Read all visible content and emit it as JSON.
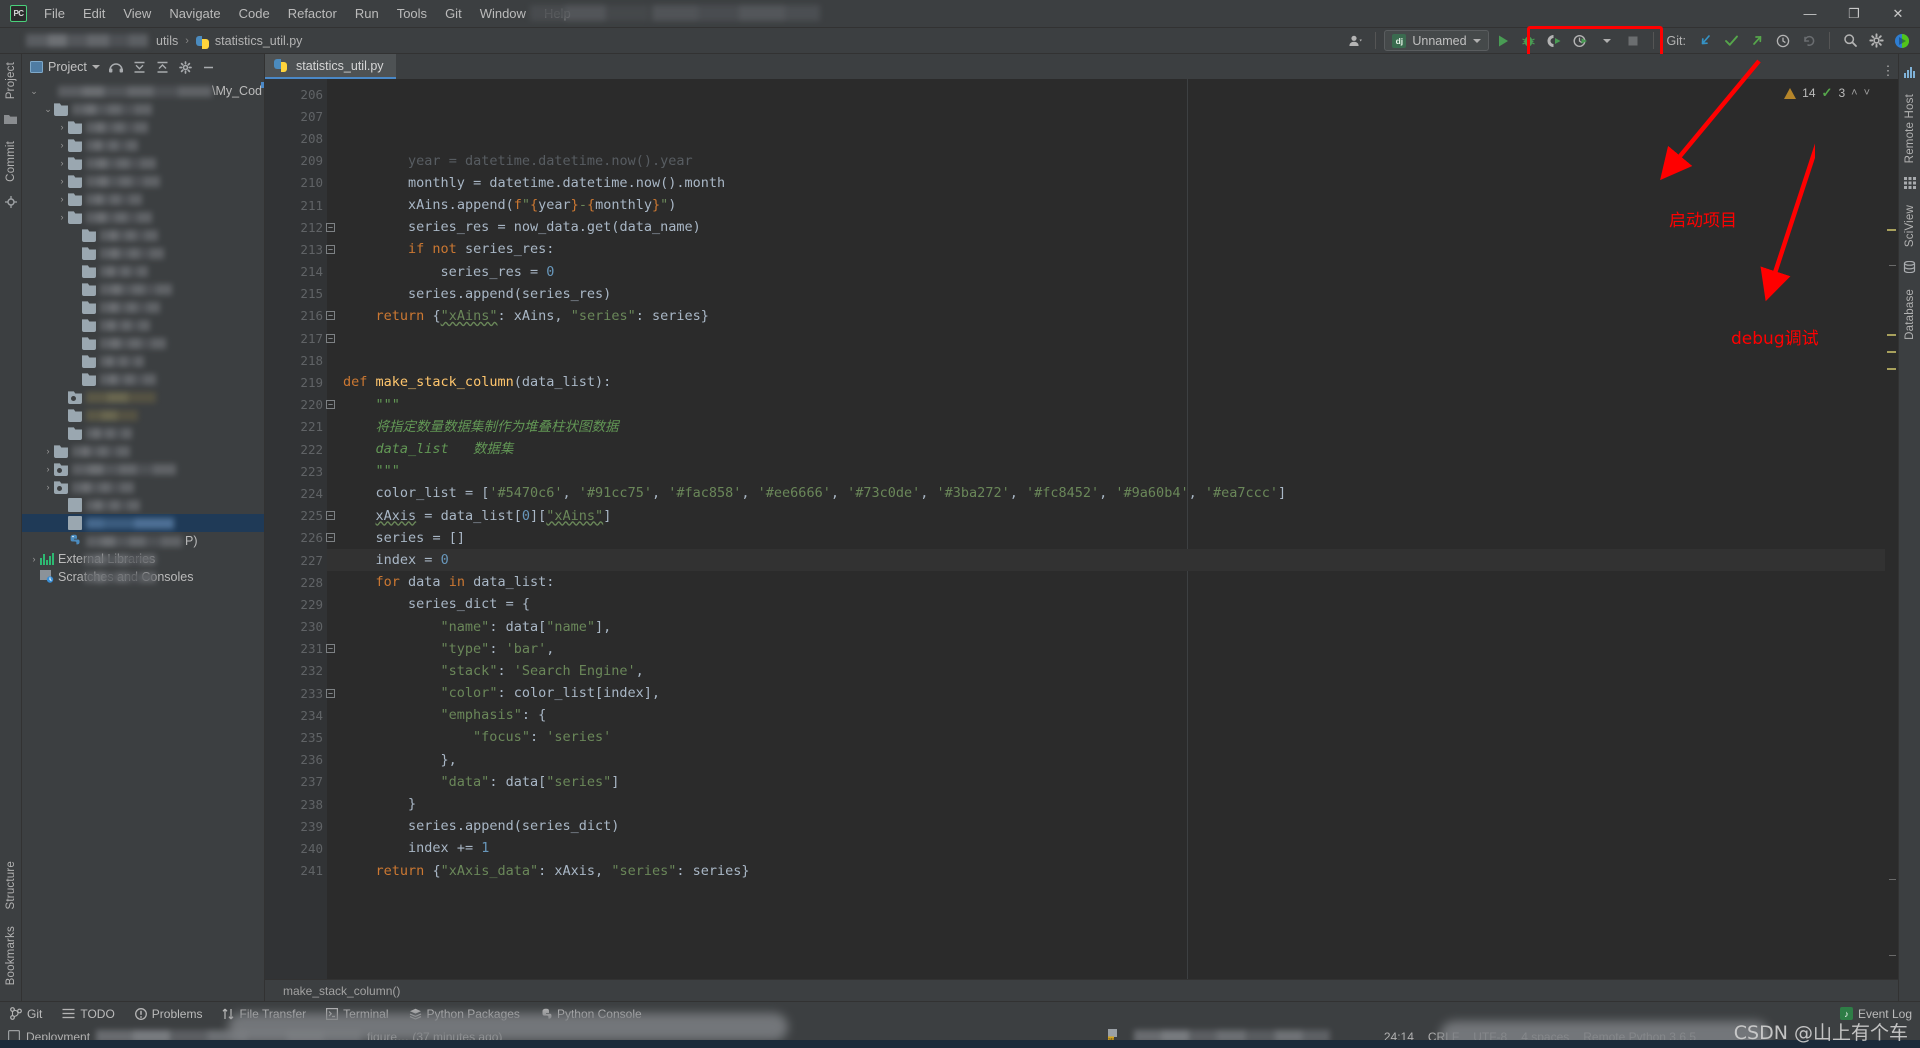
{
  "app": {
    "logo_text": "PC",
    "menu": [
      "File",
      "Edit",
      "View",
      "Navigate",
      "Code",
      "Refactor",
      "Run",
      "Tools",
      "Git",
      "Window",
      "Help"
    ],
    "window_controls": {
      "minimize": "—",
      "maximize": "❐",
      "close": "✕"
    }
  },
  "breadcrumb": {
    "project_redacted": "",
    "folder": "utils",
    "file": "statistics_util.py",
    "separator": "›"
  },
  "toolbar": {
    "avatar_label": "user-account",
    "run_config": {
      "badge": "dj",
      "name": "Unnamed"
    },
    "run_label": "Run",
    "debug_label": "Debug",
    "coverage_label": "Run with Coverage",
    "profile_label": "Profile",
    "stop_label": "Stop",
    "git_label": "Git:",
    "update_label": "Update Project",
    "commit_label": "Commit",
    "push_label": "Push",
    "history_label": "History",
    "rollback_label": "Rollback",
    "search_label": "Search Everywhere",
    "settings_label": "Settings",
    "ide_label": "IDE Feature Trainer"
  },
  "sidebar_left": {
    "tabs_top": [
      "Project",
      "Commit"
    ],
    "tabs_bottom": [
      "Structure",
      "Bookmarks"
    ]
  },
  "sidebar_right": {
    "tabs": [
      "Remote Host",
      "SciView",
      "Database"
    ]
  },
  "project_panel": {
    "title": "Project",
    "actions": [
      "hide-tabs-icon",
      "expand-all-icon",
      "collapse-all-icon",
      "settings-icon",
      "hide-icon"
    ],
    "root_suffix": "\\My_Cod",
    "tree": [
      {
        "indent": 0,
        "arrow": "⌄",
        "icon": "none",
        "label": "",
        "blur": true,
        "blur_w": 176,
        "root": true
      },
      {
        "indent": 1,
        "arrow": "⌄",
        "icon": "folder",
        "label": "",
        "blur": true,
        "blur_w": 80
      },
      {
        "indent": 2,
        "arrow": "›",
        "icon": "folder",
        "label": "",
        "blur": true,
        "blur_w": 62
      },
      {
        "indent": 2,
        "arrow": "›",
        "icon": "folder",
        "label": "",
        "blur": true,
        "blur_w": 52
      },
      {
        "indent": 2,
        "arrow": "›",
        "icon": "folder",
        "label": "",
        "blur": true,
        "blur_w": 70
      },
      {
        "indent": 2,
        "arrow": "›",
        "icon": "folder",
        "label": "",
        "blur": true,
        "blur_w": 74
      },
      {
        "indent": 2,
        "arrow": "›",
        "icon": "folder",
        "label": "",
        "blur": true,
        "blur_w": 56
      },
      {
        "indent": 2,
        "arrow": "›",
        "icon": "folder",
        "label": "",
        "blur": true,
        "blur_w": 66
      },
      {
        "indent": 3,
        "arrow": "",
        "icon": "folder",
        "label": "",
        "blur": true,
        "blur_w": 58
      },
      {
        "indent": 3,
        "arrow": "",
        "icon": "folder",
        "label": "",
        "blur": true,
        "blur_w": 64
      },
      {
        "indent": 3,
        "arrow": "",
        "icon": "folder",
        "label": "",
        "blur": true,
        "blur_w": 48
      },
      {
        "indent": 3,
        "arrow": "",
        "icon": "folder",
        "label": "",
        "blur": true,
        "blur_w": 72
      },
      {
        "indent": 3,
        "arrow": "",
        "icon": "folder",
        "label": "",
        "blur": true,
        "blur_w": 60
      },
      {
        "indent": 3,
        "arrow": "",
        "icon": "folder",
        "label": "",
        "blur": true,
        "blur_w": 50
      },
      {
        "indent": 3,
        "arrow": "",
        "icon": "folder",
        "label": "",
        "blur": true,
        "blur_w": 66
      },
      {
        "indent": 3,
        "arrow": "",
        "icon": "folder",
        "label": "",
        "blur": true,
        "blur_w": 44
      },
      {
        "indent": 3,
        "arrow": "",
        "icon": "folder",
        "label": "",
        "blur": true,
        "blur_w": 56
      },
      {
        "indent": 2,
        "arrow": "",
        "icon": "pkg",
        "label": "",
        "blur": true,
        "blur_w": 70,
        "warm": true
      },
      {
        "indent": 2,
        "arrow": "",
        "icon": "folder",
        "label": "",
        "blur": true,
        "blur_w": 52,
        "warm": true
      },
      {
        "indent": 2,
        "arrow": "",
        "icon": "folder",
        "label": "",
        "blur": true,
        "blur_w": 46
      },
      {
        "indent": 1,
        "arrow": "›",
        "icon": "folder",
        "label": "",
        "blur": true,
        "blur_w": 58
      },
      {
        "indent": 1,
        "arrow": "›",
        "icon": "pkg",
        "label": "",
        "blur": true,
        "blur_w": 104
      },
      {
        "indent": 1,
        "arrow": "›",
        "icon": "pkg",
        "label": "",
        "blur": true,
        "blur_w": 62
      },
      {
        "indent": 2,
        "arrow": "",
        "icon": "file",
        "label": "",
        "blur": true,
        "blur_w": 54
      },
      {
        "indent": 2,
        "arrow": "",
        "icon": "file",
        "label": "",
        "blur": true,
        "blur_w": 88,
        "selected": true
      },
      {
        "indent": 2,
        "arrow": "",
        "icon": "py",
        "label": "",
        "blur": true,
        "blur_w": 96,
        "suffix": "P)"
      },
      {
        "indent": 0,
        "arrow": "›",
        "icon": "lib",
        "label": "External Libraries",
        "blur": false,
        "partial_blur": true
      },
      {
        "indent": 0,
        "arrow": "",
        "icon": "scratch",
        "label": "Scratches and Consoles",
        "blur": false,
        "partial_blur": true
      }
    ]
  },
  "editor": {
    "tab": {
      "label": "statistics_util.py",
      "icon": "python-file-icon"
    },
    "inspection": {
      "warning_count": "14",
      "ok_count": "3",
      "up": "˄",
      "down": "˅"
    },
    "method_breadcrumb": "make_stack_column()",
    "first_line_number": 206,
    "current_line": 224,
    "lines": [
      {
        "n": 206,
        "html": "        <span class='def'>year</span> <span class='pn'>=</span> <span class='def'>datetime</span><span class='pn'>.</span><span class='def'>datetime</span><span class='pn'>.</span><span class='def'>now</span><span class='pn'>().</span><span class='def'>year</span>",
        "clipped": true
      },
      {
        "n": 207,
        "html": "        <span class='def'>monthly</span> <span class='pn'>=</span> <span class='def'>datetime</span><span class='pn'>.</span><span class='def'>datetime</span><span class='pn'>.</span><span class='def'>now</span><span class='pn'>().</span><span class='def'>month</span>"
      },
      {
        "n": 208,
        "html": "        <span class='def'>xAins</span><span class='pn'>.</span><span class='def'>append</span><span class='pn'>(</span><span class='kw'>f</span><span class='str'>\"</span><span class='kw'>{</span><span class='def'>year</span><span class='kw'>}</span><span class='str'>-</span><span class='kw'>{</span><span class='def'>monthly</span><span class='kw'>}</span><span class='str'>\"</span><span class='pn'>)</span>"
      },
      {
        "n": 209,
        "html": "        <span class='def'>series_res</span> <span class='pn'>=</span> <span class='def'>now_data</span><span class='pn'>.</span><span class='def'>get</span><span class='pn'>(</span><span class='def'>data_name</span><span class='pn'>)</span>"
      },
      {
        "n": 210,
        "html": "        <span class='kw'>if not</span> <span class='def'>series_res</span><span class='pn'>:</span>"
      },
      {
        "n": 211,
        "html": "            <span class='def'>series_res</span> <span class='pn'>=</span> <span class='num'>0</span>"
      },
      {
        "n": 212,
        "html": "        <span class='def'>series</span><span class='pn'>.</span><span class='def'>append</span><span class='pn'>(</span><span class='def'>series_res</span><span class='pn'>)</span>",
        "fold": true
      },
      {
        "n": 213,
        "html": "    <span class='kw'>return</span> <span class='pn'>{</span><span class='str err'>\"xAins\"</span><span class='pn'>:</span> <span class='def'>xAins</span><span class='pn'>,</span> <span class='str'>\"series\"</span><span class='pn'>:</span> <span class='def'>series</span><span class='pn'>}</span>",
        "fold": true
      },
      {
        "n": 214,
        "html": ""
      },
      {
        "n": 215,
        "html": ""
      },
      {
        "n": 216,
        "html": "<span class='kw'>def</span> <span class='fn'>make_stack_column</span><span class='pn'>(</span><span class='def'>data_list</span><span class='pn'>):</span>",
        "fold": true
      },
      {
        "n": 217,
        "html": "    <span class='cm'>\"\"\"</span>",
        "fold": true
      },
      {
        "n": 218,
        "html": "    <span class='cm'>将指定数量数据集制作为堆叠柱状图数据</span>"
      },
      {
        "n": 219,
        "html": "    <span class='cm'>data_list   数据集</span>"
      },
      {
        "n": 220,
        "html": "    <span class='cm'>\"\"\"</span>",
        "fold": true
      },
      {
        "n": 221,
        "html": "    <span class='def'>color_list</span> <span class='pn'>=</span> <span class='pn'>[</span><span class='str'>'#5470c6'</span><span class='pn'>,</span> <span class='str'>'#91cc75'</span><span class='pn'>,</span> <span class='str'>'#fac858'</span><span class='pn'>,</span> <span class='str'>'#ee6666'</span><span class='pn'>,</span> <span class='str'>'#73c0de'</span><span class='pn'>,</span> <span class='str'>'#3ba272'</span><span class='pn'>,</span> <span class='str'>'#fc8452'</span><span class='pn'>,</span> <span class='str'>'#9a60b4'</span><span class='pn'>,</span> <span class='str'>'#ea7ccc'</span><span class='pn'>]</span>"
      },
      {
        "n": 222,
        "html": "    <span class='def err'>xAxis</span> <span class='pn'>=</span> <span class='def'>data_list</span><span class='pn'>[</span><span class='num'>0</span><span class='pn'>][</span><span class='str err'>\"xAins\"</span><span class='pn'>]</span>"
      },
      {
        "n": 223,
        "html": "    <span class='def'>series</span> <span class='pn'>=</span> <span class='pn'>[]</span>"
      },
      {
        "n": 224,
        "html": "    <span class='def'>index</span> <span class='pn'>=</span> <span class='num'>0</span>",
        "current": true
      },
      {
        "n": 225,
        "html": "    <span class='kw'>for</span> <span class='def'>data</span> <span class='kw'>in</span> <span class='def'>data_list</span><span class='pn'>:</span>",
        "fold": true
      },
      {
        "n": 226,
        "html": "        <span class='def'>series_dict</span> <span class='pn'>=</span> <span class='pn'>{</span>",
        "fold": true
      },
      {
        "n": 227,
        "html": "            <span class='str'>\"name\"</span><span class='pn'>:</span> <span class='def'>data</span><span class='pn'>[</span><span class='str'>\"name\"</span><span class='pn'>],</span>"
      },
      {
        "n": 228,
        "html": "            <span class='str'>\"type\"</span><span class='pn'>:</span> <span class='str'>'bar'</span><span class='pn'>,</span>"
      },
      {
        "n": 229,
        "html": "            <span class='str'>\"stack\"</span><span class='pn'>:</span> <span class='str'>'Search Engine'</span><span class='pn'>,</span>"
      },
      {
        "n": 230,
        "html": "            <span class='str'>\"color\"</span><span class='pn'>:</span> <span class='def'>color_list</span><span class='pn'>[</span><span class='def'>index</span><span class='pn'>],</span>"
      },
      {
        "n": 231,
        "html": "            <span class='str'>\"emphasis\"</span><span class='pn'>:</span> <span class='pn'>{</span>",
        "fold": true
      },
      {
        "n": 232,
        "html": "                <span class='str'>\"focus\"</span><span class='pn'>:</span> <span class='str'>'series'</span>"
      },
      {
        "n": 233,
        "html": "            <span class='pn'>},</span>",
        "fold": true
      },
      {
        "n": 234,
        "html": "            <span class='str'>\"data\"</span><span class='pn'>:</span> <span class='def'>data</span><span class='pn'>[</span><span class='str'>\"series\"</span><span class='pn'>]</span>"
      },
      {
        "n": 235,
        "html": "        <span class='pn'>}</span>"
      },
      {
        "n": 236,
        "html": "        <span class='def'>series</span><span class='pn'>.</span><span class='def'>append</span><span class='pn'>(</span><span class='def'>series_dict</span><span class='pn'>)</span>"
      },
      {
        "n": 237,
        "html": "        <span class='def'>index</span> <span class='pn'>+=</span> <span class='num'>1</span>"
      },
      {
        "n": 238,
        "html": "    <span class='kw'>return</span> <span class='pn'>{</span><span class='str'>\"xAxis_data\"</span><span class='pn'>:</span> <span class='def'>xAxis</span><span class='pn'>,</span> <span class='str'>\"series\"</span><span class='pn'>:</span> <span class='def'>series</span><span class='pn'>}</span>"
      },
      {
        "n": 239,
        "html": ""
      },
      {
        "n": 240,
        "html": ""
      },
      {
        "n": 241,
        "html": ""
      }
    ]
  },
  "annotations": {
    "accent_color": "#ff0000",
    "items": [
      {
        "name": "start-project",
        "text": "启动项目"
      },
      {
        "name": "debug",
        "text": "debug调试"
      }
    ]
  },
  "bottom_tools": [
    {
      "label": "Git",
      "icon": "git-branch-icon"
    },
    {
      "label": "TODO",
      "icon": "todo-list-icon"
    },
    {
      "label": "Problems",
      "icon": "problems-icon"
    },
    {
      "label": "File Transfer",
      "icon": "file-transfer-icon"
    },
    {
      "label": "Terminal",
      "icon": "terminal-icon"
    },
    {
      "label": "Python Packages",
      "icon": "packages-icon"
    },
    {
      "label": "Python Console",
      "icon": "python-console-icon"
    }
  ],
  "event_log": {
    "label": "Event Log",
    "badge": "♪"
  },
  "status_bar": {
    "deployment_label": "Deployment",
    "vcs_message_suffix": "figure… (37 minutes ago)",
    "caret_position": "24:14",
    "line_separator": "CRLF",
    "encoding": "UTF-8",
    "indent": "4 spaces",
    "interpreter": "Remote Python 3.6.5",
    "lock_icon": "lock-icon"
  },
  "watermark": "CSDN @山上有个车"
}
